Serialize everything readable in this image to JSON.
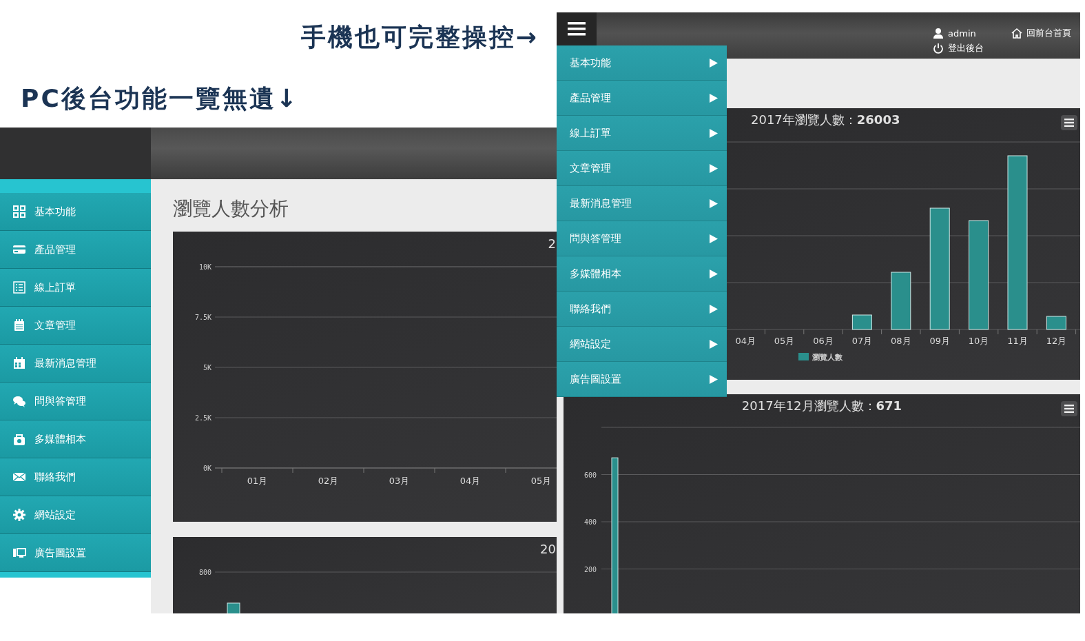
{
  "captions": {
    "mobile": "手機也可完整操控→",
    "pc": "PC後台功能一覽無遺↓"
  },
  "pc": {
    "sidebar": {
      "items": [
        {
          "label": "基本功能"
        },
        {
          "label": "產品管理"
        },
        {
          "label": "線上訂單"
        },
        {
          "label": "文章管理"
        },
        {
          "label": "最新消息管理"
        },
        {
          "label": "問與答管理"
        },
        {
          "label": "多媒體相本"
        },
        {
          "label": "聯絡我們"
        },
        {
          "label": "網站設定"
        },
        {
          "label": "廣告圖設置"
        }
      ]
    },
    "page_title": "瀏覽人數分析",
    "charts": [
      {
        "kind": "chart",
        "title": "2",
        "chart_data": {
          "type": "bar",
          "categories": [
            "01月",
            "02月",
            "03月",
            "04月",
            "05月"
          ],
          "values": [
            0,
            0,
            0,
            0,
            0
          ],
          "ylim": [
            0,
            10000
          ],
          "yticks": [
            {
              "value": 0,
              "label": "0K"
            },
            {
              "value": 2500,
              "label": "2.5K"
            },
            {
              "value": 5000,
              "label": "5K"
            },
            {
              "value": 7500,
              "label": "7.5K"
            },
            {
              "value": 10000,
              "label": "10K"
            }
          ],
          "grid": true
        }
      },
      {
        "kind": "picture",
        "title": "20",
        "y_labels": [
          "800"
        ]
      }
    ]
  },
  "mobile": {
    "user": "admin",
    "logout": "登出後台",
    "home_link": "回前台首頁",
    "menu": [
      {
        "label": "基本功能"
      },
      {
        "label": "產品管理"
      },
      {
        "label": "線上訂單"
      },
      {
        "label": "文章管理"
      },
      {
        "label": "最新消息管理"
      },
      {
        "label": "問與答管理"
      },
      {
        "label": "多媒體相本"
      },
      {
        "label": "聯絡我們"
      },
      {
        "label": "網站設定"
      },
      {
        "label": "廣告圖設置"
      }
    ],
    "charts": [
      {
        "kind": "picture",
        "title": "2017年瀏覽人數：**26003**",
        "x_labels": [
          "04月",
          "05月",
          "06月",
          "07月",
          "08月",
          "09月",
          "10月",
          "11月",
          "12月"
        ],
        "legend": "瀏覽人數"
      },
      {
        "kind": "chart",
        "title": "2017年12月瀏覽人數：**671**",
        "chart_data": {
          "type": "bar",
          "values": [
            671
          ],
          "ylim": [
            0,
            800
          ],
          "yticks": [
            200,
            400,
            600
          ],
          "grid": true
        }
      }
    ]
  }
}
